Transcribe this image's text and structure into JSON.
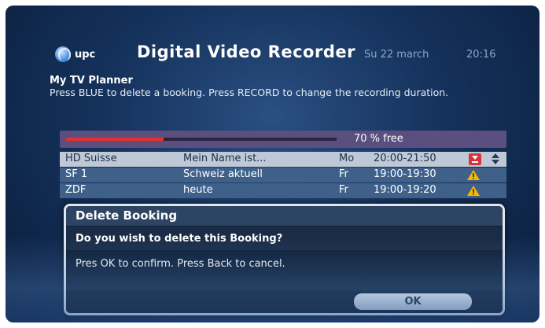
{
  "header": {
    "logo_text": "upc",
    "title": "Digital Video Recorder",
    "date": "Su 22 march",
    "time": "20:16"
  },
  "planner": {
    "heading": "My TV Planner",
    "instructions": "Press BLUE to delete a booking. Press RECORD to change the recording duration."
  },
  "storage": {
    "free_label": "70 % free",
    "used_fraction": 0.36
  },
  "bookings": [
    {
      "channel": "HD Suisse",
      "title": "Mein Name ist...",
      "day": "Mo",
      "time": "20:00-21:50",
      "icon": "record-icon",
      "selected": true
    },
    {
      "channel": "SF 1",
      "title": "Schweiz aktuell",
      "day": "Fr",
      "time": "19:00-19:30",
      "icon": "warning-icon",
      "selected": false
    },
    {
      "channel": "ZDF",
      "title": "heute",
      "day": "Fr",
      "time": "19:00-19:20",
      "icon": "warning-icon",
      "selected": false
    }
  ],
  "dialog": {
    "title": "Delete Booking",
    "question": "Do you wish to delete this Booking?",
    "message": "Pres OK to confirm. Press Back to cancel.",
    "ok_label": "OK"
  },
  "colors": {
    "accent_red": "#e8302a",
    "warning_yellow": "#f5b800",
    "background_blue": "#15325c"
  }
}
